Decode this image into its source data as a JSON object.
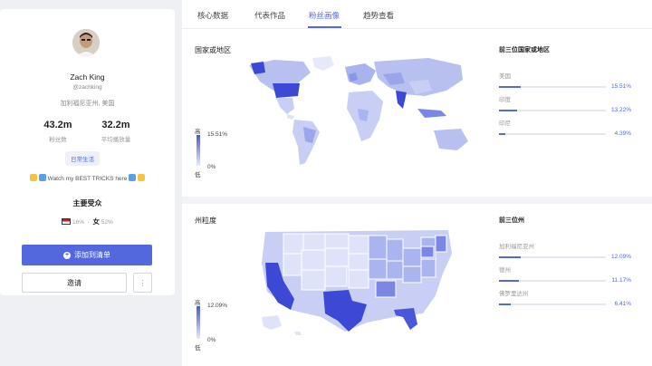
{
  "profile": {
    "name": "Zach King",
    "handle": "@zachking",
    "location": "加利福尼亚州, 美国",
    "stats": [
      {
        "value": "43.2m",
        "label": "粉丝数"
      },
      {
        "value": "32.2m",
        "label": "平均播放量"
      }
    ],
    "tag": "日常生活",
    "bio": "Watch my BEST TRICKS here",
    "audience_title": "主要受众",
    "audience_country_pct": "16%",
    "audience_gender": "女",
    "audience_gender_pct": "52%",
    "add_button": "添加到清单",
    "invite_button": "邀请",
    "more_button": "⋮"
  },
  "tabs": [
    "核心数据",
    "代表作品",
    "粉丝画像",
    "趋势查看"
  ],
  "active_tab": "粉丝画像",
  "country_section": {
    "title": "国家或地区",
    "legend": {
      "high": "高",
      "low": "低",
      "max": "15.51%",
      "min": "0%"
    },
    "top_title": "前三位国家或地区",
    "top": [
      {
        "name": "美国",
        "pct": "15.51%",
        "value": 15.51
      },
      {
        "name": "印度",
        "pct": "13.22%",
        "value": 13.22
      },
      {
        "name": "印尼",
        "pct": "4.39%",
        "value": 4.39
      }
    ]
  },
  "state_section": {
    "title": "州粒度",
    "legend": {
      "high": "高",
      "low": "低",
      "max": "12.09%",
      "min": "0%"
    },
    "top_title": "前三位州",
    "top": [
      {
        "name": "加利福尼亚州",
        "pct": "12.09%",
        "value": 12.09
      },
      {
        "name": "德州",
        "pct": "11.17%",
        "value": 11.17
      },
      {
        "name": "佛罗里达州",
        "pct": "6.41%",
        "value": 6.41
      }
    ]
  },
  "colors": {
    "accent": "#5468de",
    "map_light": "#dfe3f9",
    "map_mid": "#a9b3ef",
    "map_dark": "#3b49d4"
  }
}
